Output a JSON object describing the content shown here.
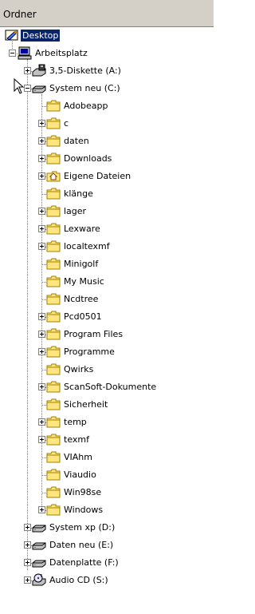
{
  "header": {
    "title": "Ordner"
  },
  "tree": [
    {
      "label": "Desktop",
      "level": 0,
      "icon": "desktop-icon",
      "expander": "none",
      "selected": true
    },
    {
      "label": "Arbeitsplatz",
      "level": 1,
      "icon": "computer-icon",
      "expander": "minus"
    },
    {
      "label": "3,5-Diskette (A:)",
      "level": 2,
      "icon": "floppy-drive-icon",
      "expander": "plus"
    },
    {
      "label": "System neu (C:)",
      "level": 2,
      "icon": "hard-drive-icon",
      "expander": "minus"
    },
    {
      "label": "Adobeapp",
      "level": 3,
      "icon": "folder-icon",
      "expander": "none"
    },
    {
      "label": "c",
      "level": 3,
      "icon": "folder-icon",
      "expander": "plus"
    },
    {
      "label": "daten",
      "level": 3,
      "icon": "folder-icon",
      "expander": "plus"
    },
    {
      "label": "Downloads",
      "level": 3,
      "icon": "folder-icon",
      "expander": "plus"
    },
    {
      "label": "Eigene Dateien",
      "level": 3,
      "icon": "home-folder-icon",
      "expander": "plus"
    },
    {
      "label": "klänge",
      "level": 3,
      "icon": "folder-icon",
      "expander": "none"
    },
    {
      "label": "lager",
      "level": 3,
      "icon": "folder-icon",
      "expander": "plus"
    },
    {
      "label": "Lexware",
      "level": 3,
      "icon": "folder-icon",
      "expander": "plus"
    },
    {
      "label": "localtexmf",
      "level": 3,
      "icon": "folder-icon",
      "expander": "plus"
    },
    {
      "label": "Minigolf",
      "level": 3,
      "icon": "folder-icon",
      "expander": "none"
    },
    {
      "label": "My Music",
      "level": 3,
      "icon": "folder-icon",
      "expander": "none"
    },
    {
      "label": "Ncdtree",
      "level": 3,
      "icon": "folder-icon",
      "expander": "none"
    },
    {
      "label": "Pcd0501",
      "level": 3,
      "icon": "folder-icon",
      "expander": "plus"
    },
    {
      "label": "Program Files",
      "level": 3,
      "icon": "folder-icon",
      "expander": "plus"
    },
    {
      "label": "Programme",
      "level": 3,
      "icon": "folder-icon",
      "expander": "plus"
    },
    {
      "label": "Qwirks",
      "level": 3,
      "icon": "folder-icon",
      "expander": "none"
    },
    {
      "label": "ScanSoft-Dokumente",
      "level": 3,
      "icon": "folder-icon",
      "expander": "plus"
    },
    {
      "label": "Sicherheit",
      "level": 3,
      "icon": "folder-icon",
      "expander": "none"
    },
    {
      "label": "temp",
      "level": 3,
      "icon": "folder-icon",
      "expander": "plus"
    },
    {
      "label": "texmf",
      "level": 3,
      "icon": "folder-icon",
      "expander": "plus"
    },
    {
      "label": "VIAhm",
      "level": 3,
      "icon": "folder-icon",
      "expander": "none"
    },
    {
      "label": "Viaudio",
      "level": 3,
      "icon": "folder-icon",
      "expander": "none"
    },
    {
      "label": "Win98se",
      "level": 3,
      "icon": "folder-icon",
      "expander": "none"
    },
    {
      "label": "Windows",
      "level": 3,
      "icon": "folder-icon",
      "expander": "plus"
    },
    {
      "label": "System xp (D:)",
      "level": 2,
      "icon": "hard-drive-icon",
      "expander": "plus"
    },
    {
      "label": "Daten neu (E:)",
      "level": 2,
      "icon": "hard-drive-icon",
      "expander": "plus"
    },
    {
      "label": "Datenplatte (F:)",
      "level": 2,
      "icon": "hard-drive-icon",
      "expander": "plus"
    },
    {
      "label": "Audio CD (S:)",
      "level": 2,
      "icon": "audio-cd-icon",
      "expander": "plus"
    }
  ],
  "colors": {
    "header_bg": "#d4d0c8",
    "selection_bg": "#0a246a",
    "folder_yellow": "#ffe680",
    "folder_outline": "#a08000"
  }
}
